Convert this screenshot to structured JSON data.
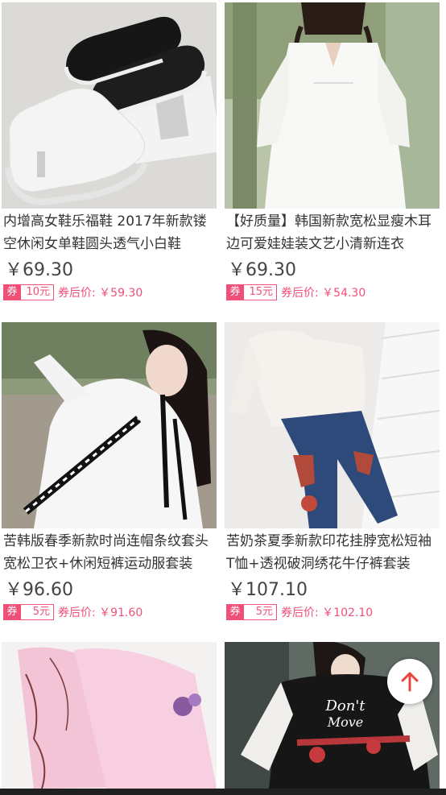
{
  "products": [
    {
      "title": "内增高女鞋乐福鞋 2017年新款镂空休闲女单鞋圆头透气小白鞋",
      "price": "￥69.30",
      "coupon_label": "券",
      "coupon_value": "10元",
      "after_price": "券后价: ￥59.30",
      "image": "white-and-black-perforated-slip-on-sneakers"
    },
    {
      "title": "【好质量】韩国新款宽松显瘦木耳边可爱娃娃装文艺小清新连衣",
      "price": "￥69.30",
      "coupon_label": "券",
      "coupon_value": "15元",
      "after_price": "券后价: ￥54.30",
      "image": "white-ruffled-babydoll-dress"
    },
    {
      "title": "苦韩版春季新款时尚连帽条纹套头宽松卫衣+休闲短裤运动服套装",
      "price": "￥96.60",
      "coupon_label": "券",
      "coupon_value": "5元",
      "after_price": "券后价: ￥91.60",
      "image": "white-hoodie-with-striped-drawstrings"
    },
    {
      "title": "苦奶茶夏季新款印花挂脖宽松短袖T恤+透视破洞绣花牛仔裤套装",
      "price": "￥107.10",
      "coupon_label": "券",
      "coupon_value": "5元",
      "after_price": "券后价: ￥102.10",
      "image": "white-tee-and-embroidered-ripped-jeans"
    },
    {
      "title": "",
      "image": "pink-lace-lingerie"
    },
    {
      "title": "",
      "image": "black-lace-sleeve-tee"
    }
  ],
  "colors": {
    "accent": "#f05078",
    "fab_arrow": "#e8453c"
  },
  "icons": {
    "fab": "arrow-up-icon"
  }
}
